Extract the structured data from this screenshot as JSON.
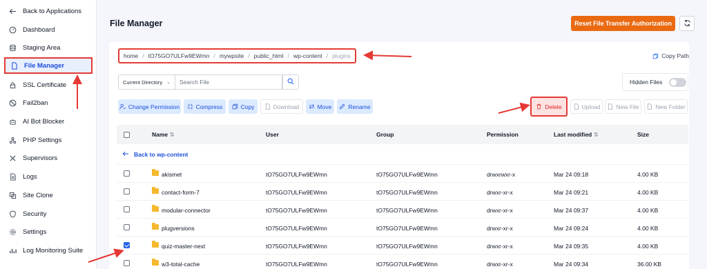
{
  "sidebar": {
    "items": [
      {
        "label": "Back to Applications",
        "icon": "arrow-left-icon"
      },
      {
        "label": "Dashboard",
        "icon": "gauge-icon"
      },
      {
        "label": "Staging Area",
        "icon": "database-icon"
      },
      {
        "label": "File Manager",
        "icon": "file-icon",
        "active": true
      },
      {
        "label": "SSL Certificate",
        "icon": "lock-icon"
      },
      {
        "label": "Fail2ban",
        "icon": "ban-icon"
      },
      {
        "label": "AI Bot Blocker",
        "icon": "robot-icon"
      },
      {
        "label": "PHP Settings",
        "icon": "php-icon"
      },
      {
        "label": "Supervisors",
        "icon": "tools-icon"
      },
      {
        "label": "Logs",
        "icon": "document-icon"
      },
      {
        "label": "Site Clone",
        "icon": "clone-icon"
      },
      {
        "label": "Security",
        "icon": "shield-icon"
      },
      {
        "label": "Settings",
        "icon": "gear-icon"
      },
      {
        "label": "Log Monitoring Suite",
        "icon": "chart-icon"
      }
    ]
  },
  "header": {
    "title": "File Manager",
    "reset_label": "Reset File Transfer Authorization",
    "accent_color": "#ea6a12"
  },
  "breadcrumb": [
    "home",
    "tO75GO7ULFw9EWmn",
    "mywpsite",
    "public_html",
    "wp-content",
    "plugins"
  ],
  "copy_path_label": "Copy Path",
  "search": {
    "directory_label": "Current Directory",
    "placeholder": "Search File"
  },
  "hidden_files_label": "Hidden Files",
  "toolbar": {
    "change_permission": "Change Permission",
    "compress": "Compress",
    "copy": "Copy",
    "download": "Download",
    "move": "Move",
    "rename": "Rename",
    "delete": "Delete",
    "upload": "Upload",
    "new_file": "New File",
    "new_folder": "New Folder"
  },
  "table": {
    "headers": {
      "name": "Name",
      "user": "User",
      "group": "Group",
      "permission": "Permission",
      "last_modified": "Last modified",
      "size": "Size"
    },
    "back_label": "Back to wp-content",
    "rows": [
      {
        "name": "akismet",
        "user": "tO75GO7ULFw9EWmn",
        "group": "tO75GO7ULFw9EWmn",
        "permission": "drwxrwxr-x",
        "modified": "Mar 24 09:18",
        "size": "4.00 KB",
        "checked": false
      },
      {
        "name": "contact-form-7",
        "user": "tO75GO7ULFw9EWmn",
        "group": "tO75GO7ULFw9EWmn",
        "permission": "drwxr-xr-x",
        "modified": "Mar 24 09:21",
        "size": "4.00 KB",
        "checked": false
      },
      {
        "name": "modular-connector",
        "user": "tO75GO7ULFw9EWmn",
        "group": "tO75GO7ULFw9EWmn",
        "permission": "drwxr-xr-x",
        "modified": "Mar 24 09:37",
        "size": "4.00 KB",
        "checked": false
      },
      {
        "name": "plugversions",
        "user": "tO75GO7ULFw9EWmn",
        "group": "tO75GO7ULFw9EWmn",
        "permission": "drwxr-xr-x",
        "modified": "Mar 24 09:24",
        "size": "4.00 KB",
        "checked": false
      },
      {
        "name": "quiz-master-next",
        "user": "tO75GO7ULFw9EWmn",
        "group": "tO75GO7ULFw9EWmn",
        "permission": "drwxr-xr-x",
        "modified": "Mar 24 09:35",
        "size": "4.00 KB",
        "checked": true
      },
      {
        "name": "w3-total-cache",
        "user": "tO75GO7ULFw9EWmn",
        "group": "tO75GO7ULFw9EWmn",
        "permission": "drwxr-xr-x",
        "modified": "Mar 24 09:34",
        "size": "36.00 KB",
        "checked": false
      }
    ]
  }
}
